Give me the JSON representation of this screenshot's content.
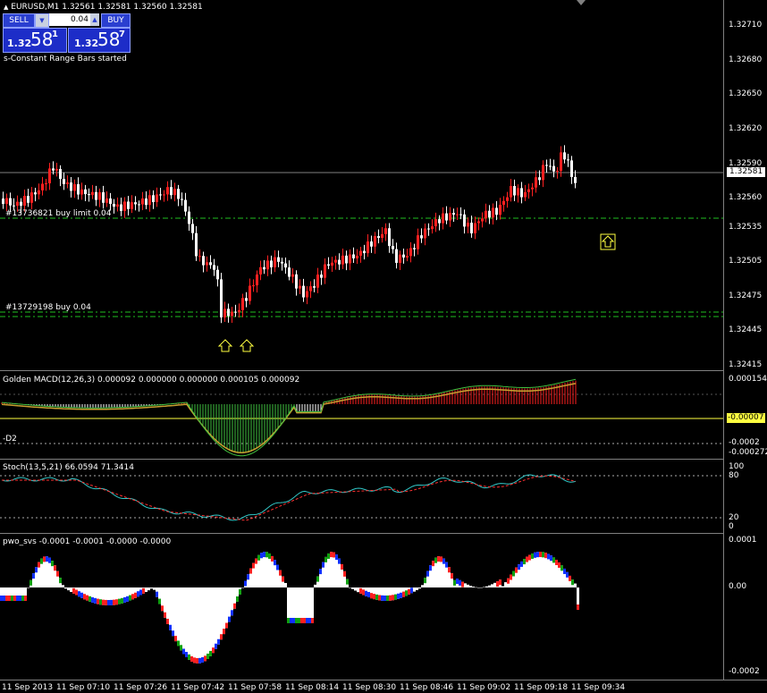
{
  "header": {
    "symbol_line": "EURUSD,M1  1.32561 1.32581 1.32560 1.32581",
    "status": "s-Constant Range Bars started"
  },
  "trade_panel": {
    "sell_label": "SELL",
    "buy_label": "BUY",
    "lot_value": "0.04",
    "sell_big": "1.32",
    "sell_pips": "58",
    "sell_sup": "1",
    "buy_big": "1.32",
    "buy_pips": "58",
    "buy_sup": "7"
  },
  "orders": [
    {
      "label": "#13736821 buy limit 0.04"
    },
    {
      "label": "#13729198 buy 0.04"
    }
  ],
  "price_axis": {
    "labels": [
      "1.32710",
      "1.32680",
      "1.32650",
      "1.32620",
      "1.32590",
      "1.32560",
      "1.32535",
      "1.32505",
      "1.32475",
      "1.32445",
      "1.32415"
    ],
    "current": "1.32581"
  },
  "macd": {
    "title": "Golden MACD(12,26,3) 0.000092 0.000000 0.000000 0.000105 0.000092",
    "left_label": "-D2",
    "axis": [
      "0.000154",
      "-0.0002",
      "-0.000272"
    ],
    "current": "-0.00007"
  },
  "stoch": {
    "title": "Stoch(13,5,21) 66.0594 71.3414",
    "axis": [
      "100",
      "80",
      "20",
      "0"
    ]
  },
  "pwo": {
    "title": "pwo_svs -0.0001 -0.0001 -0.0000 -0.0000",
    "axis": [
      "0.0001",
      "0.00",
      "-0.0002"
    ]
  },
  "time_axis": [
    "11 Sep 2013",
    "11 Sep 07:10",
    "11 Sep 07:26",
    "11 Sep 07:42",
    "11 Sep 07:58",
    "11 Sep 08:14",
    "11 Sep 08:30",
    "11 Sep 08:46",
    "11 Sep 09:02",
    "11 Sep 09:18",
    "11 Sep 09:34"
  ],
  "colors": {
    "bull": "#ff2020",
    "bear": "#ffffff",
    "order_line": "#20c020",
    "macd_bar": "#ffffff",
    "macd_signal_hi": "#c89b3c",
    "stoch_main": "#32c8c8",
    "stoch_signal": "#ff3030",
    "pwo_blue": "#1030ff",
    "pwo_green": "#10a010",
    "arrow": "#ffff40"
  }
}
